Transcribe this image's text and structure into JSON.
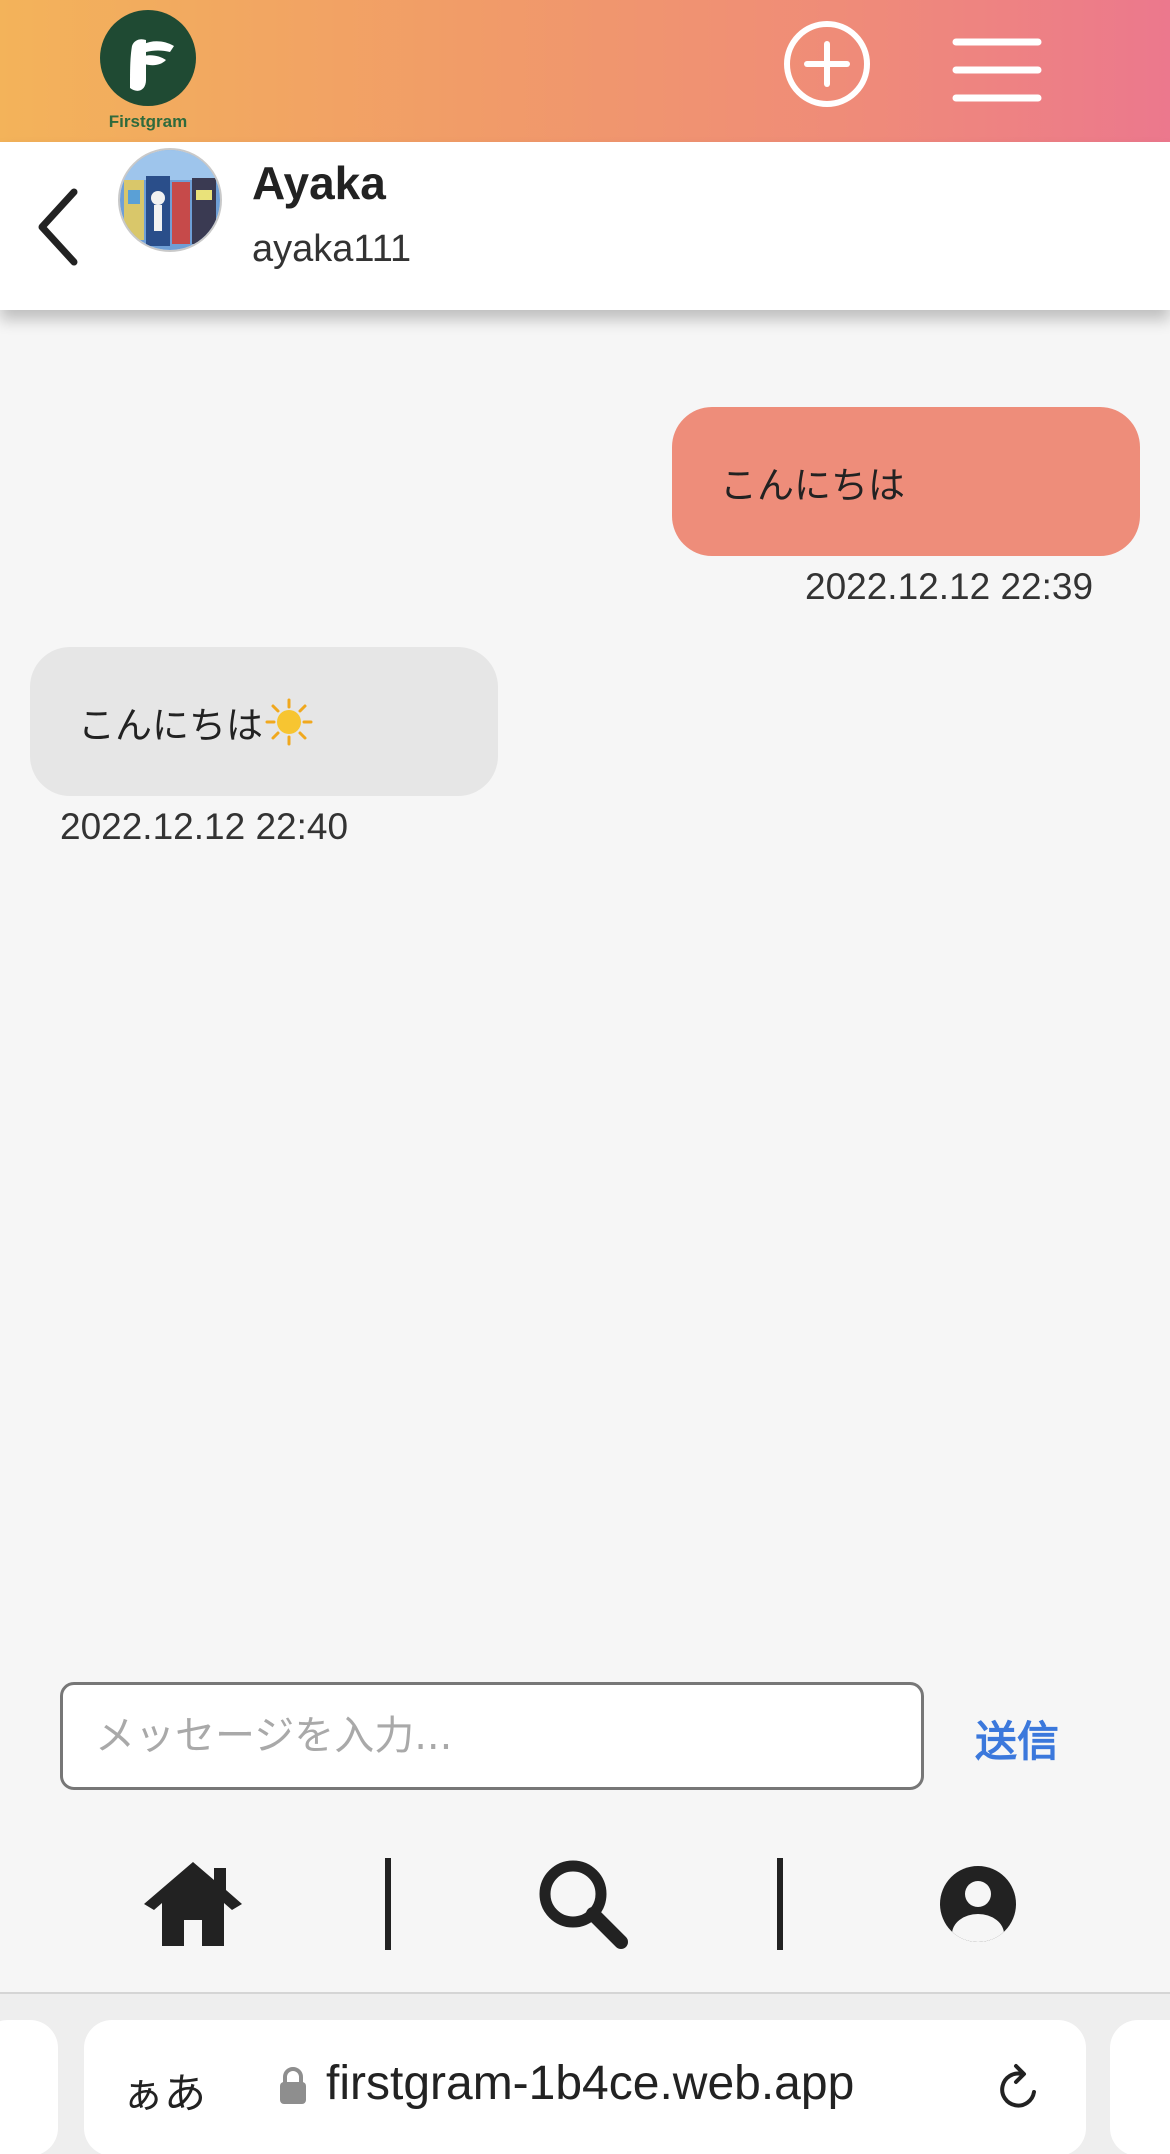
{
  "app": {
    "logo_text": "Firstgram",
    "brand_colors": {
      "gradient_start": "#f3b35a",
      "gradient_end": "#ec788d",
      "logo_bg": "#1f4a33"
    },
    "header_icons": [
      "add-circle-icon",
      "hamburger-menu-icon"
    ]
  },
  "chat_header": {
    "back_icon": "chevron-left-icon",
    "name": "Ayaka",
    "username": "ayaka111"
  },
  "messages": [
    {
      "direction": "sent",
      "text": "こんにちは",
      "timestamp": "2022.12.12 22:39",
      "bubble_color": "#ee8d7a"
    },
    {
      "direction": "received",
      "text": "こんにちは",
      "emoji": "sun-icon",
      "timestamp": "2022.12.12 22:40",
      "bubble_color": "#e6e6e6"
    }
  ],
  "composer": {
    "placeholder": "メッセージを入力...",
    "value": "",
    "send_label": "送信",
    "send_color": "#3b78dc"
  },
  "bottom_nav": {
    "items": [
      {
        "icon": "home-icon"
      },
      {
        "icon": "search-icon"
      },
      {
        "icon": "profile-icon"
      }
    ]
  },
  "browser": {
    "text_size_label": "ぁあ",
    "url": "firstgram-1b4ce.web.app",
    "lock_icon": "lock-icon",
    "reload_icon": "reload-icon"
  }
}
